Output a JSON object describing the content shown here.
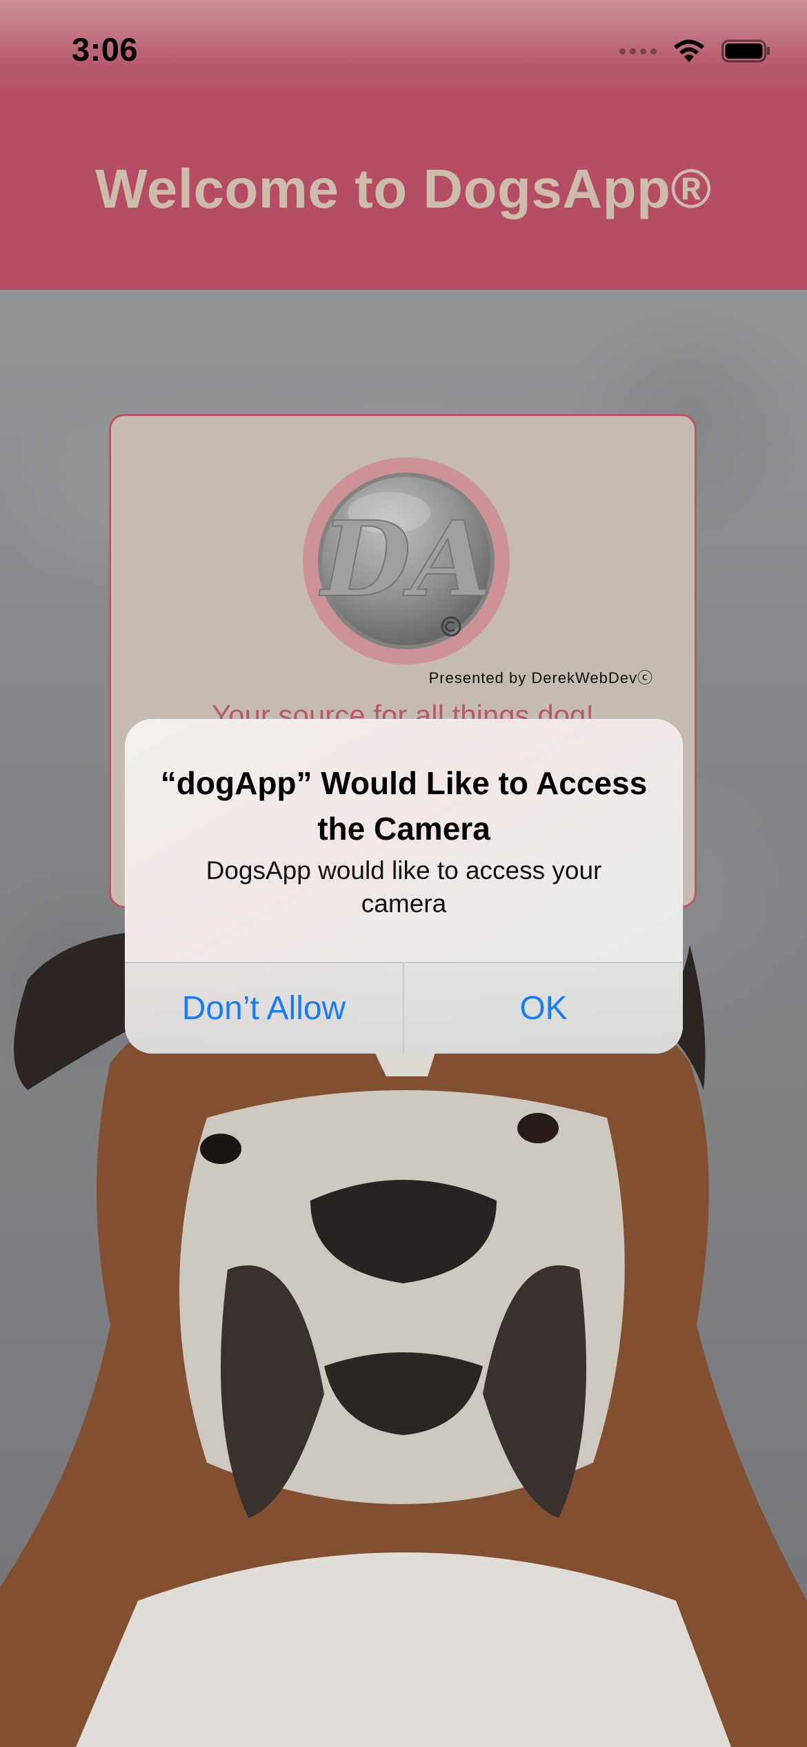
{
  "status_bar": {
    "time": "3:06",
    "icons": [
      "signal-dots-icon",
      "wifi-icon",
      "battery-icon"
    ]
  },
  "header": {
    "title": "Welcome to DogsApp®"
  },
  "card": {
    "logo_letters": "DA",
    "presented_by": "Presented by DerekWebDevⓒ",
    "tagline": "Your source for all things dog!"
  },
  "alert": {
    "title": "“dogApp” Would Like to Access the Camera",
    "message": "DogsApp would like to access your camera",
    "deny_label": "Don’t Allow",
    "allow_label": "OK"
  },
  "colors": {
    "header": "#bf526a",
    "title_text": "#d8c7b6",
    "card_bg": "#d0c6b8",
    "card_border": "#c45a6f",
    "alert_button": "#1a7cf5"
  }
}
